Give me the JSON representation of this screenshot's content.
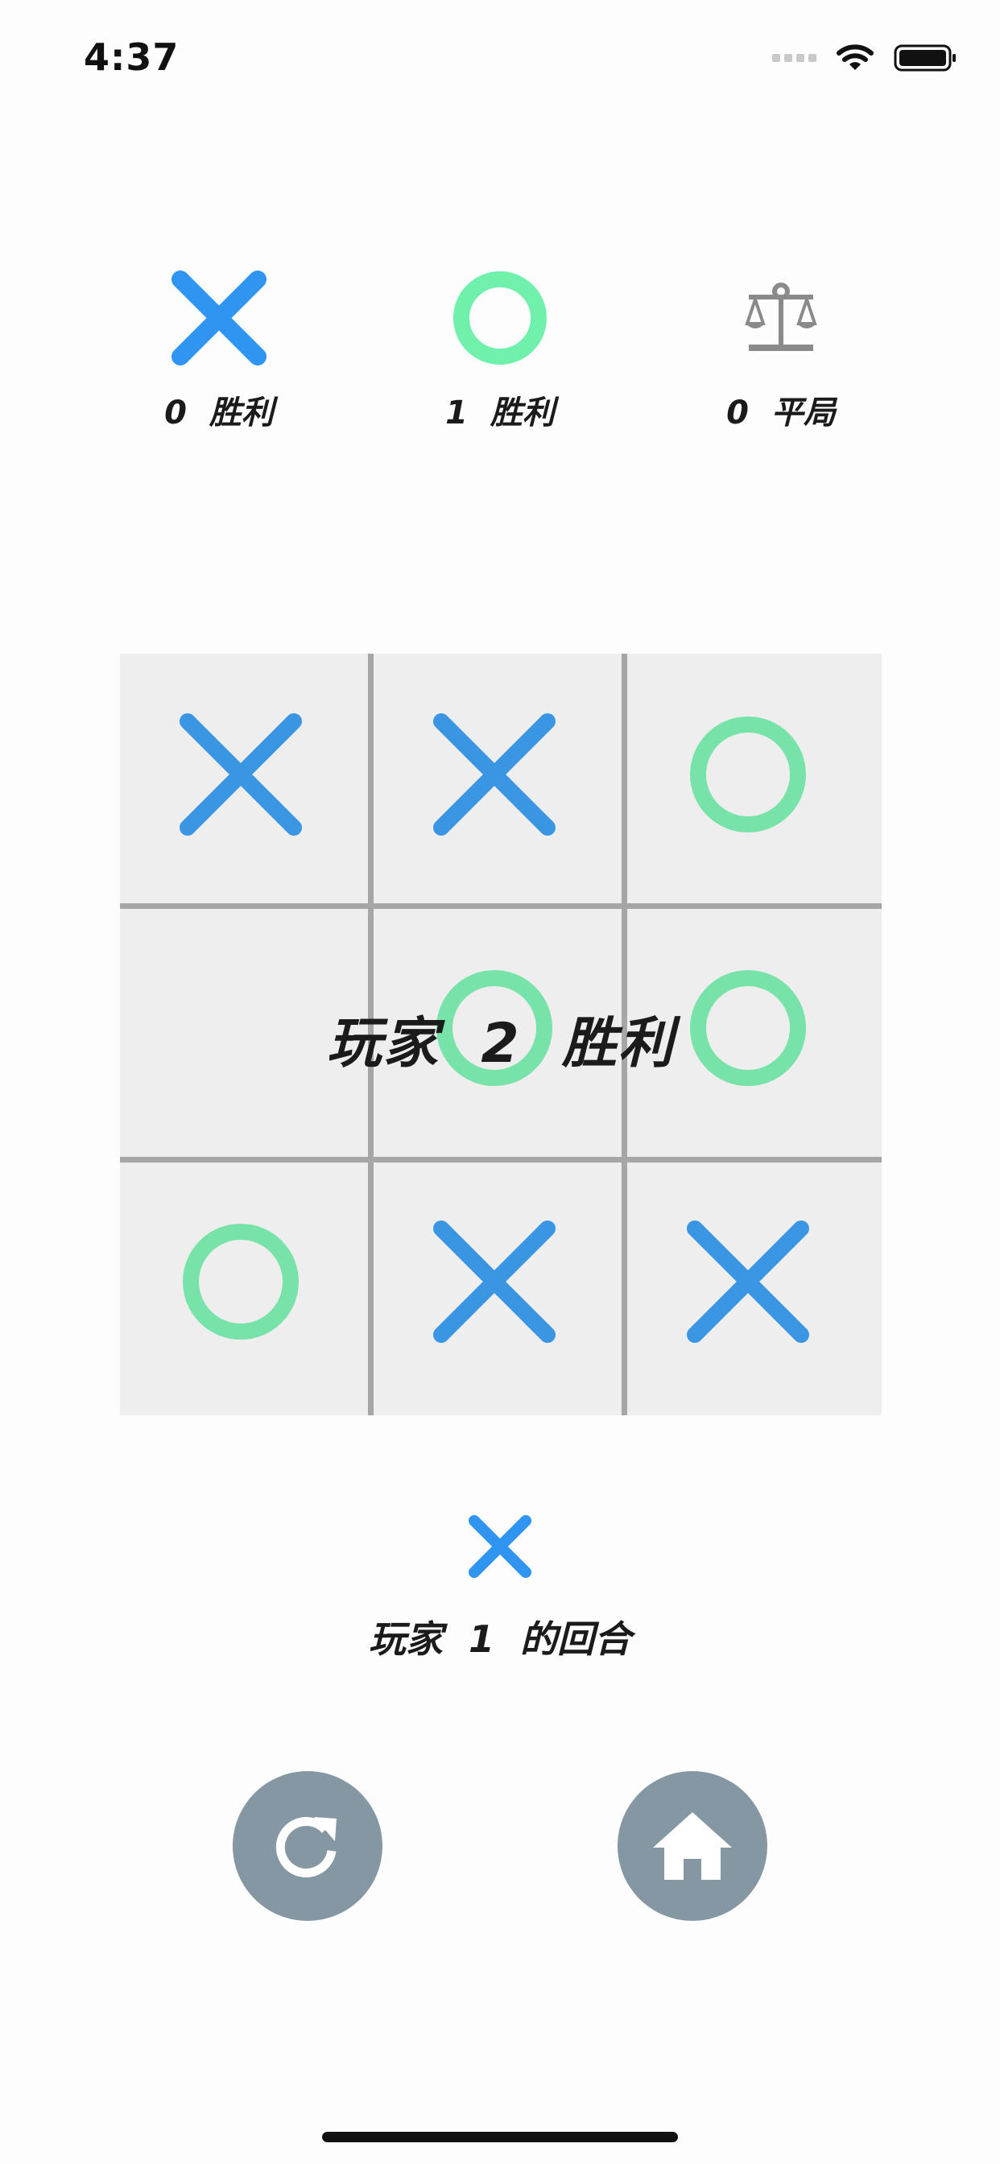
{
  "status_bar": {
    "time": "4:37"
  },
  "colors": {
    "x": "#3a96e3",
    "o": "#78e3a9",
    "x_header": "#2f95f0",
    "o_header": "#6ff0ab",
    "button": "#8497a2"
  },
  "scoreboard": {
    "x_wins_label": "0  胜利",
    "o_wins_label": "1  胜利",
    "draws_label": "0  平局",
    "icons": [
      "x-mark-icon",
      "o-mark-icon",
      "balance-scale-icon"
    ]
  },
  "board": {
    "cells": [
      "X",
      "X",
      "O",
      "",
      "O",
      "O",
      "O",
      "X",
      "X"
    ]
  },
  "result": {
    "winner_text": "玩家  2  胜利"
  },
  "turn": {
    "mark": "X",
    "label": "玩家  1  的回合"
  },
  "buttons": {
    "restart_icon": "restart-icon",
    "home_icon": "home-icon"
  }
}
